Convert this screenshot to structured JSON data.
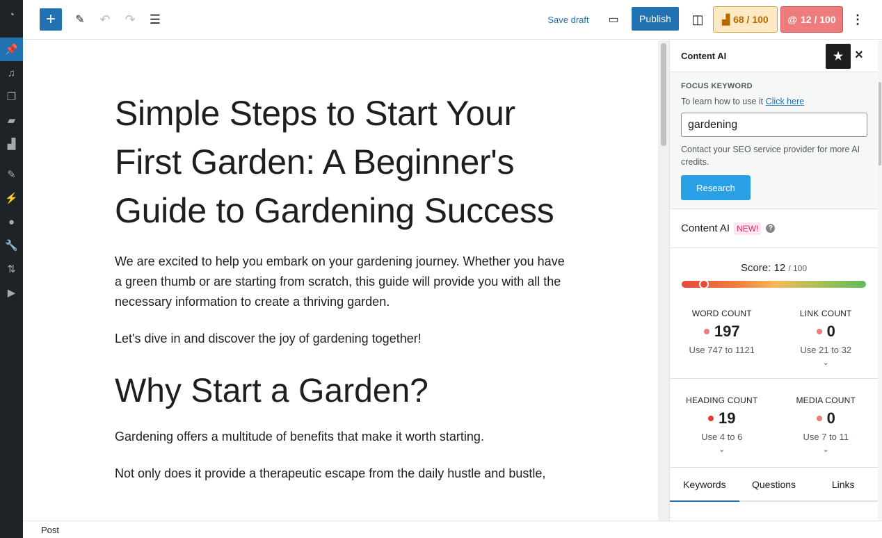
{
  "admin_menu": [
    {
      "icon": "dashboard-icon",
      "glyph": "◔"
    },
    {
      "icon": "pin-icon",
      "glyph": "📌",
      "active": true
    },
    {
      "icon": "media-icon",
      "glyph": "♫"
    },
    {
      "icon": "pages-icon",
      "glyph": "❐"
    },
    {
      "icon": "comments-icon",
      "glyph": "▰"
    },
    {
      "icon": "rankmath-icon",
      "glyph": "▟"
    },
    {
      "icon": "appearance-icon",
      "glyph": "✎"
    },
    {
      "icon": "plugins-icon",
      "glyph": "⚡"
    },
    {
      "icon": "users-icon",
      "glyph": "●"
    },
    {
      "icon": "tools-icon",
      "glyph": "🔧"
    },
    {
      "icon": "settings-icon",
      "glyph": "⇅"
    },
    {
      "icon": "play-icon",
      "glyph": "▶"
    }
  ],
  "toolbar": {
    "save_draft": "Save draft",
    "publish": "Publish",
    "seo_score": "68 / 100",
    "content_ai_score": "12 / 100"
  },
  "post": {
    "title": "Simple Steps to Start Your First Garden: A Beginner's Guide to Gardening Success",
    "paragraphs": [
      "We are excited to help you embark on your gardening journey. Whether you have a green thumb or are starting from scratch, this guide will provide you with all the necessary information to create a thriving garden.",
      "Let's dive in and discover the joy of gardening together!"
    ],
    "heading": "Why Start a Garden?",
    "paragraphs2": [
      "Gardening offers a multitude of benefits that make it worth starting.",
      "Not only does it provide a therapeutic escape from the daily hustle and bustle,"
    ]
  },
  "panel": {
    "title": "Content AI",
    "focus_label": "FOCUS KEYWORD",
    "help_text": "To learn how to use it",
    "help_link": "Click here",
    "keyword": "gardening",
    "credits": "Contact your SEO service provider for more AI credits.",
    "research": "Research",
    "section_title": "Content AI",
    "new_badge": "NEW!",
    "score_label": "Score:",
    "score": "12",
    "score_max": "/ 100",
    "score_value": 12,
    "stats": [
      {
        "label": "WORD COUNT",
        "value": "197",
        "hint": "Use 747 to 1121"
      },
      {
        "label": "LINK COUNT",
        "value": "0",
        "hint": "Use 21 to 32"
      },
      {
        "label": "HEADING COUNT",
        "value": "19",
        "hint": "Use 4 to 6"
      },
      {
        "label": "MEDIA COUNT",
        "value": "0",
        "hint": "Use 7 to 11"
      }
    ],
    "tabs": [
      "Keywords",
      "Questions",
      "Links"
    ]
  },
  "footer": {
    "breadcrumb": "Post"
  },
  "colors": {
    "accent": "#2271b1",
    "seo_badge": "#fde8c4",
    "content_ai_badge": "#ee7c7c"
  }
}
